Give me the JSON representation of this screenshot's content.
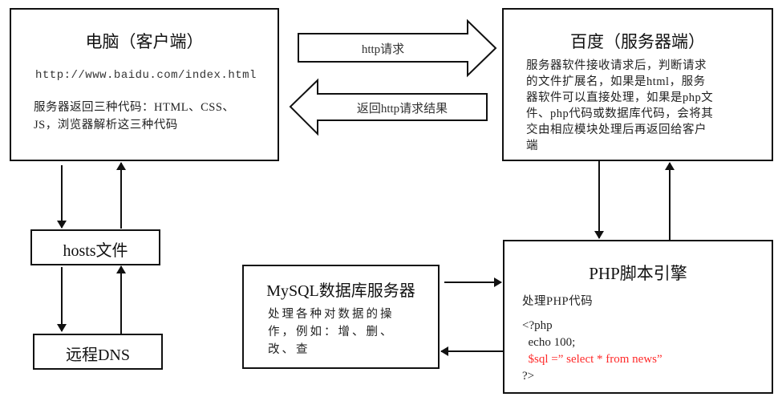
{
  "client": {
    "title": "电脑（客户端）",
    "url": "http://www.baidu.com/index.html",
    "description_line1": "服务器返回三种代码：HTML、CSS、",
    "description_line2": "JS，浏览器解析这三种代码"
  },
  "server": {
    "title": "百度（服务器端）",
    "description_lines": [
      "服务器软件接收请求后，判断请求",
      "的文件扩展名，如果是html，服务",
      "器软件可以直接处理，如果是php文",
      "件、php代码或数据库代码，会将其",
      "交由相应模块处理后再返回给客户",
      "端"
    ]
  },
  "request_arrow": {
    "label": "http请求"
  },
  "response_arrow": {
    "label": "返回http请求结果"
  },
  "hosts": {
    "label": "hosts文件"
  },
  "dns": {
    "label": "远程DNS"
  },
  "mysql": {
    "title": "MySQL数据库服务器",
    "description_lines": [
      "处理各种对数据的操",
      "作，例如：增、删、",
      "改、查"
    ]
  },
  "php": {
    "title": "PHP脚本引擎",
    "subtitle": "处理PHP代码",
    "code_lines": [
      {
        "text": "<?php",
        "highlight": false
      },
      {
        "text": "  echo 100;",
        "highlight": false
      },
      {
        "text": "  $sql =” select * from news”",
        "highlight": true
      },
      {
        "text": "?>",
        "highlight": false
      }
    ]
  },
  "colors": {
    "stroke": "#111111",
    "highlight": "#ff2a2a"
  }
}
